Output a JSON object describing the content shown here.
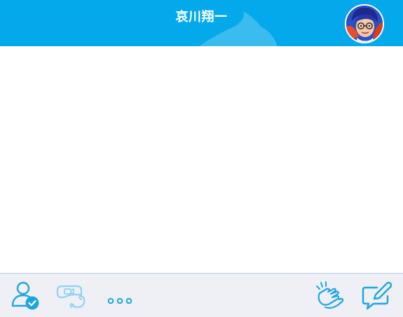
{
  "header": {
    "title": "哀川翔一",
    "background_color": "#03a9ea"
  },
  "avatar": {
    "icon": "profile-avatar"
  },
  "toolbar": {
    "accent_color": "#1ea5e0",
    "left_buttons": [
      {
        "name": "contact-profile-button",
        "icon": "person-check-icon"
      },
      {
        "name": "video-call-button",
        "icon": "video-phone-icon"
      },
      {
        "name": "more-button",
        "icon": "more-dots-icon"
      }
    ],
    "right_buttons": [
      {
        "name": "clap-reaction-button",
        "icon": "clapping-hands-icon"
      },
      {
        "name": "compose-message-button",
        "icon": "compose-icon"
      }
    ]
  }
}
